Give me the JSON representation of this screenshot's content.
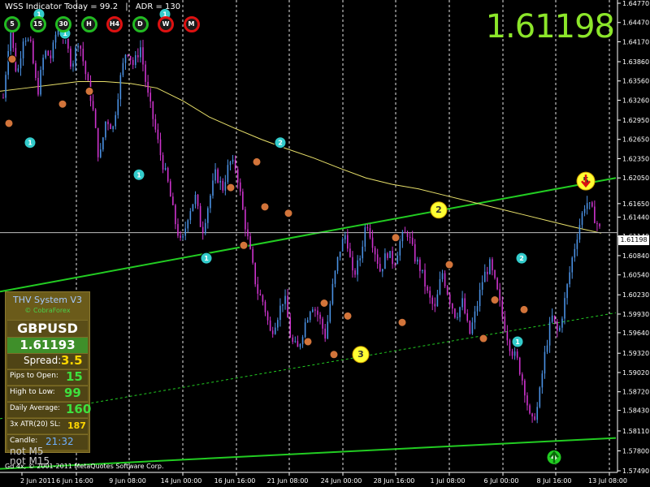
{
  "header": {
    "indicator_text": "WSS Indicator Today = 99.2",
    "separator": "|",
    "adr_text": "ADR = 130"
  },
  "big_price": "1.61198",
  "current_price_tag": "1.61198",
  "timeframes": [
    {
      "label": "5",
      "color": "#22bb22"
    },
    {
      "label": "15",
      "color": "#22bb22"
    },
    {
      "label": "30",
      "color": "#22bb22"
    },
    {
      "label": "H",
      "color": "#22bb22"
    },
    {
      "label": "H4",
      "color": "#dd1111"
    },
    {
      "label": "D",
      "color": "#22bb22"
    },
    {
      "label": "W",
      "color": "#dd1111"
    },
    {
      "label": "M",
      "color": "#dd1111"
    }
  ],
  "panel": {
    "title": "THV System V3",
    "subtitle": "© CobraForex",
    "symbol": "GBPUSD",
    "price": "1.61193",
    "spread_label": "Spread:",
    "spread_value": "3.5",
    "pips_label": "Pips to Open:",
    "pips_value": "15",
    "hl_label": "High to Low:",
    "hl_value": "99",
    "avg_label": "Daily Average:",
    "avg_value": "160",
    "atr_label": "3x ATR(20) SL:",
    "atr_value": "187",
    "candle_label": "Candle:",
    "candle_value": "21:32"
  },
  "ghost_text": [
    "not M5",
    "not M15"
  ],
  "copyright": "Gd 4x, © 2001-2011 MetaQuotes Software Corp.",
  "colors": {
    "background": "#000000",
    "bull_candle": "#4a90e2",
    "bear_candle": "#cc33cc",
    "moving_average": "#e8e06a",
    "channel": "#22cc22",
    "price_line": "#c0c0c0",
    "grid": "#ffffff"
  },
  "chart_data": {
    "type": "candlestick",
    "symbol": "GBPUSD",
    "y_ticks": [
      "1.64770",
      "1.64470",
      "1.64170",
      "1.63860",
      "1.63560",
      "1.63260",
      "1.62950",
      "1.62650",
      "1.62350",
      "1.62050",
      "1.61650",
      "1.61440",
      "1.61140",
      "1.60840",
      "1.60540",
      "1.60230",
      "1.59930",
      "1.59640",
      "1.59320",
      "1.59020",
      "1.58720",
      "1.58430",
      "1.58110",
      "1.57800",
      "1.57490"
    ],
    "ylim": [
      1.5749,
      1.6477
    ],
    "x_ticks": [
      "2 Jun 2011",
      "6 Jun 16:00",
      "9 Jun 08:00",
      "14 Jun 00:00",
      "16 Jun 16:00",
      "21 Jun 08:00",
      "24 Jun 00:00",
      "28 Jun 16:00",
      "1 Jul 08:00",
      "6 Jul 00:00",
      "8 Jul 16:00",
      "13 Jul 08:00"
    ],
    "close_path": [
      1.633,
      1.644,
      1.6362,
      1.643,
      1.641,
      1.6336,
      1.6402,
      1.6392,
      1.6448,
      1.6421,
      1.638,
      1.6423,
      1.6368,
      1.6318,
      1.623,
      1.6298,
      1.6282,
      1.6355,
      1.6408,
      1.638,
      1.641,
      1.6338,
      1.629,
      1.6238,
      1.6198,
      1.614,
      1.6098,
      1.615,
      1.6176,
      1.612,
      1.6168,
      1.6213,
      1.6188,
      1.623,
      1.622,
      1.615,
      1.609,
      1.603,
      1.601,
      1.5962,
      1.599,
      1.6022,
      1.595,
      1.5938,
      1.5978,
      1.601,
      1.599,
      1.5958,
      1.6032,
      1.609,
      1.612,
      1.605,
      1.6078,
      1.614,
      1.61,
      1.606,
      1.609,
      1.6072,
      1.611,
      1.612,
      1.6082,
      1.606,
      1.602,
      1.6,
      1.606,
      1.602,
      1.599,
      1.6012,
      1.596,
      1.6,
      1.605,
      1.607,
      1.603,
      1.598,
      1.594,
      1.592,
      1.588,
      1.582,
      1.585,
      1.593,
      1.599,
      1.596,
      1.602,
      1.608,
      1.613,
      1.617,
      1.615,
      1.6125
    ],
    "moving_average": [
      1.634,
      1.6345,
      1.635,
      1.6355,
      1.6355,
      1.6352,
      1.6345,
      1.6325,
      1.63,
      1.6282,
      1.6265,
      1.625,
      1.6236,
      1.622,
      1.6205,
      1.6195,
      1.6188,
      1.6178,
      1.6168,
      1.6158,
      1.6148,
      1.6138,
      1.6128,
      1.6119
    ],
    "channel_top": {
      "from": [
        1.6028,
        "left"
      ],
      "to": [
        1.6205,
        "right"
      ]
    },
    "channel_mid": {
      "from": [
        1.583,
        "left"
      ],
      "to": [
        1.5995,
        "right"
      ]
    },
    "channel_bottom": {
      "from": [
        1.5752,
        "left"
      ],
      "to": [
        1.58,
        "right"
      ]
    },
    "marker_labels": [
      "1",
      "2",
      "3",
      "4",
      "5"
    ]
  }
}
